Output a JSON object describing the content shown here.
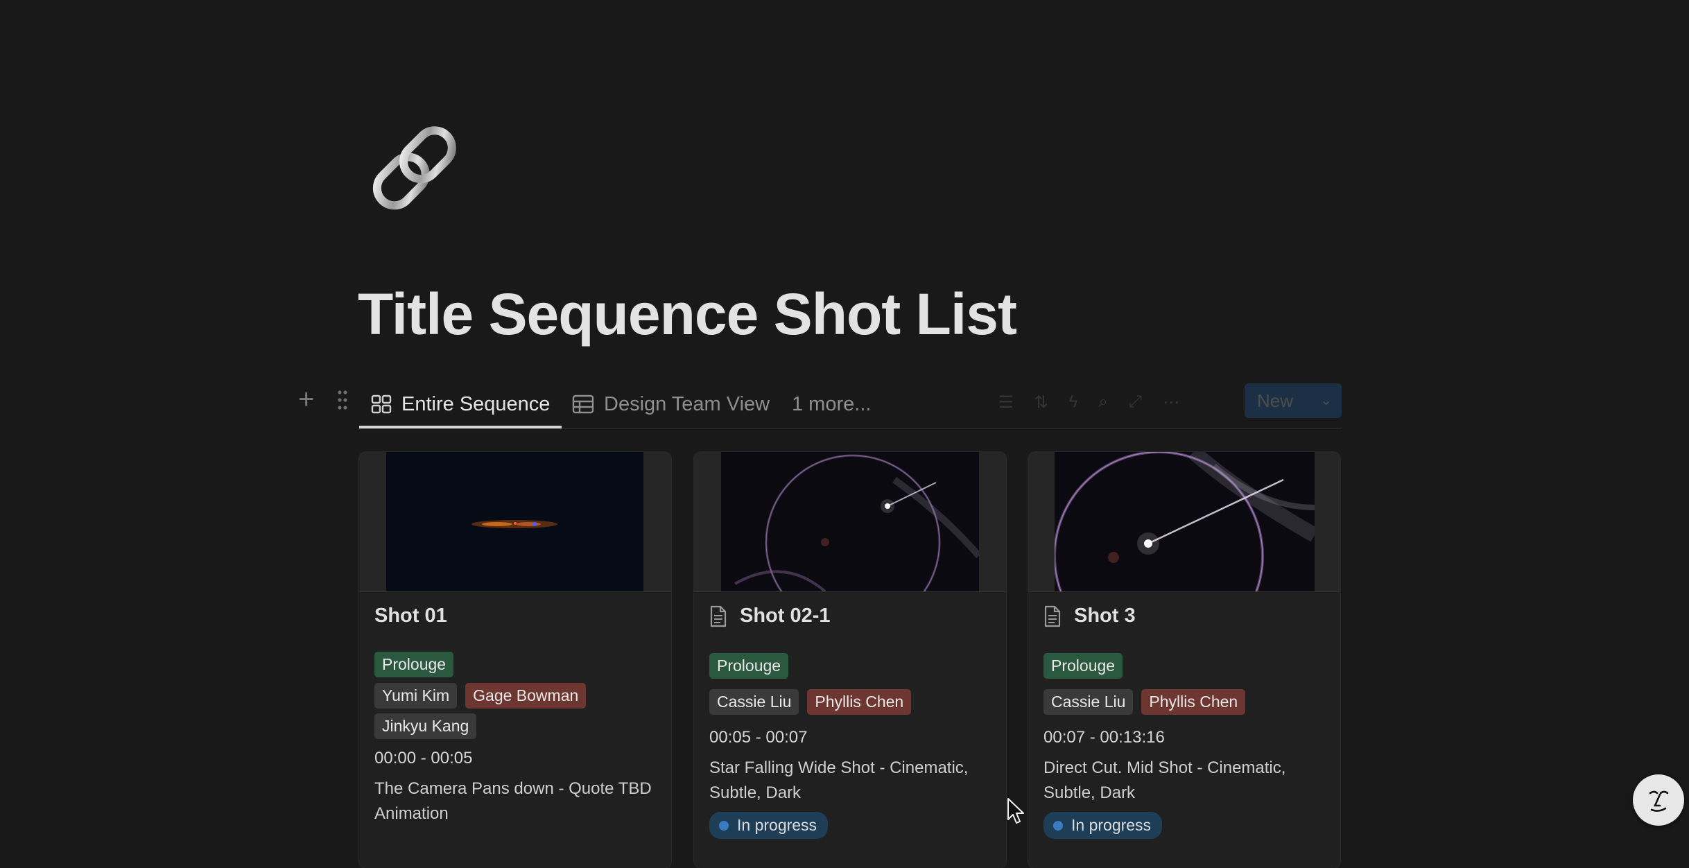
{
  "page": {
    "icon": "chain-link-icon",
    "title": "Title Sequence Shot List"
  },
  "views": {
    "tabs": [
      {
        "label": "Entire Sequence",
        "icon": "gallery-icon",
        "active": true
      },
      {
        "label": "Design Team View",
        "icon": "table-icon",
        "active": false
      }
    ],
    "more_label": "1 more...",
    "new_label": "New"
  },
  "cards": [
    {
      "title": "Shot 01",
      "stage": "Prolouge",
      "people": [
        {
          "name": "Yumi Kim",
          "color": "gray"
        },
        {
          "name": "Gage Bowman",
          "color": "red"
        },
        {
          "name": "Jinkyu Kang",
          "color": "gray"
        }
      ],
      "time": "00:00 - 00:05",
      "description": "The Camera Pans down - Quote TBD Animation"
    },
    {
      "title": "Shot 02-1",
      "stage": "Prolouge",
      "people": [
        {
          "name": "Cassie Liu",
          "color": "gray"
        },
        {
          "name": "Phyllis Chen",
          "color": "red"
        }
      ],
      "time": "00:05 - 00:07",
      "description": "Star Falling Wide Shot - Cinematic, Subtle, Dark",
      "status": "In progress"
    },
    {
      "title": "Shot 3",
      "stage": "Prolouge",
      "people": [
        {
          "name": "Cassie Liu",
          "color": "gray"
        },
        {
          "name": "Phyllis Chen",
          "color": "red"
        }
      ],
      "time": "00:07 - 00:13:16",
      "description": "Direct Cut. Mid Shot - Cinematic, Subtle, Dark",
      "status": "In progress"
    }
  ],
  "colors": {
    "background": "#191919",
    "tag_green": "#2b593f",
    "tag_gray": "#3a3a3a",
    "tag_red": "#6e3630",
    "status_blue": "#1e3e58",
    "accent": "#2383e2"
  }
}
